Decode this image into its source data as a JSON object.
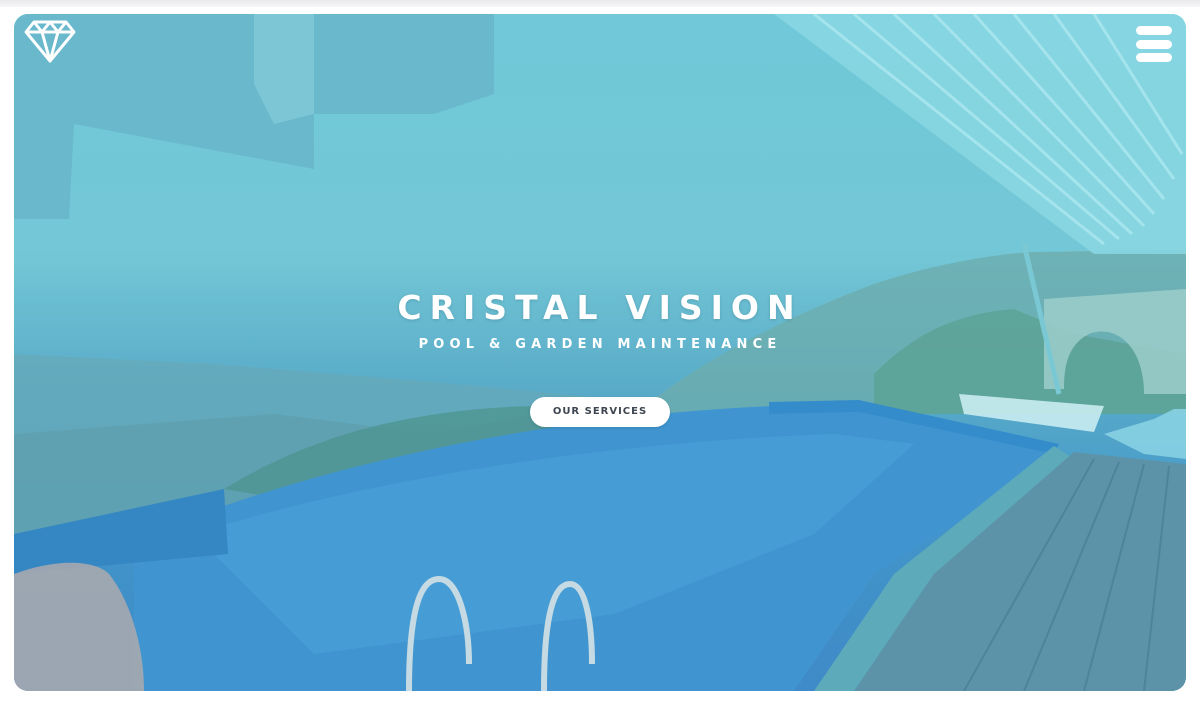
{
  "brand": {
    "logo_icon": "diamond-icon",
    "title": "CRISTAL VISION",
    "tagline": "POOL & GARDEN MAINTENANCE"
  },
  "header": {
    "menu_icon": "hamburger-menu-icon"
  },
  "hero": {
    "cta_label": "OUR SERVICES",
    "overlay_color": "#5ec6d6",
    "accent_color": "#ffffff"
  }
}
